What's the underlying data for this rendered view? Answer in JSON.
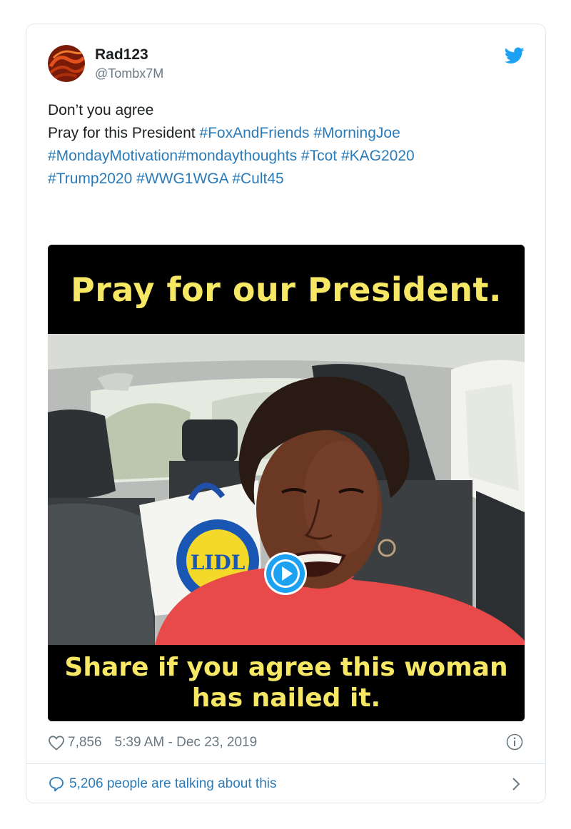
{
  "tweet": {
    "user_name": "Rad123",
    "user_handle": "@Tombx7M",
    "text_line1": "Don’t you agree",
    "text_line2_plain": "Pray for this President ",
    "hashtags": {
      "h1": "#FoxAndFriends",
      "h2": "#MorningJoe",
      "h3": "#MondayMotivation",
      "h4": "#mondaythoughts",
      "h5": "#Tcot",
      "h6": "#KAG2020",
      "h7": "#Trump2020",
      "h8": "#WWG1WGA",
      "h9": "#Cult45"
    },
    "icons": {
      "bird": "twitter-bird-icon",
      "heart": "heart-icon",
      "info": "info-icon",
      "bubble": "speech-bubble-icon",
      "chevron": "chevron-right-icon",
      "play": "play-icon"
    }
  },
  "media": {
    "caption_top": "Pray for our President.",
    "caption_bottom_line1": "Share if you agree this woman",
    "caption_bottom_line2": "has nailed it.",
    "bag_text": "LIDL"
  },
  "meta": {
    "likes": "7,856",
    "timestamp": "5:39 AM - Dec 23, 2019"
  },
  "footer": {
    "talking": "5,206 people are talking about this"
  },
  "colors": {
    "link": "#2b7bb9",
    "caption": "#f6e765",
    "muted": "#697882",
    "twitter_blue": "#1da1f2"
  }
}
